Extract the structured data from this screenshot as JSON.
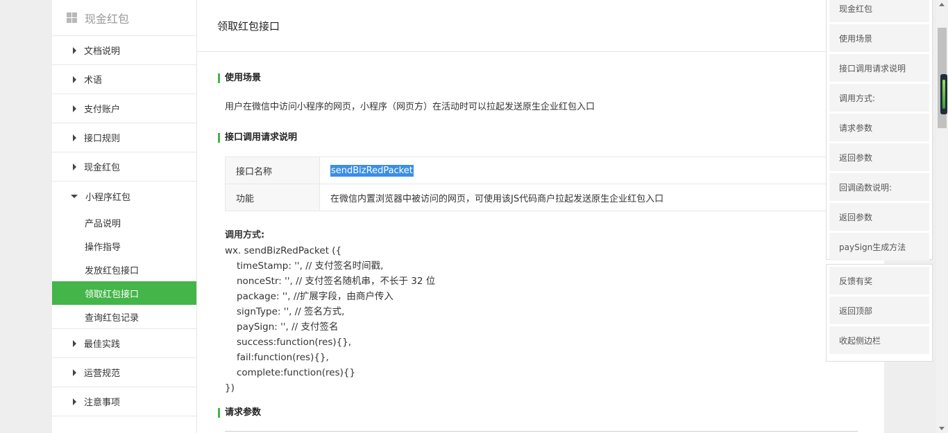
{
  "sidebar": {
    "header": "现金红包",
    "items": [
      {
        "label": "文档说明"
      },
      {
        "label": "术语"
      },
      {
        "label": "支付账户"
      },
      {
        "label": "接口规则"
      },
      {
        "label": "现金红包"
      }
    ],
    "open_group": {
      "label": "小程序红包",
      "children": [
        {
          "label": "产品说明"
        },
        {
          "label": "操作指导"
        },
        {
          "label": "发放红包接口"
        },
        {
          "label": "领取红包接口",
          "active": true
        },
        {
          "label": "查询红包记录"
        }
      ]
    },
    "after_items": [
      {
        "label": "最佳实践"
      },
      {
        "label": "运营规范"
      },
      {
        "label": "注意事项"
      }
    ]
  },
  "main": {
    "page_title": "领取红包接口",
    "sections": {
      "usage_title": "使用场景",
      "usage_text": "用户在微信中访问小程序的网页，小程序（网页方）在活动时可以拉起发送原生企业红包入口",
      "request_title": "接口调用请求说明",
      "params_title": "请求参数"
    },
    "api_table": {
      "rows": [
        {
          "key": "接口名称",
          "value": "sendBizRedPacket"
        },
        {
          "key": "功能",
          "value": "在微信内置浏览器中被访问的网页，可使用该JS代码商户拉起发送原生企业红包入口"
        }
      ]
    },
    "call_method": {
      "title": "调用方式:",
      "lines": [
        "wx. sendBizRedPacket ({",
        "timeStamp: '', // 支付签名时间戳,",
        "nonceStr: '', // 支付签名随机串，不长于 32 位",
        "package: '', //扩展字段，由商户传入",
        "signType: '', // 签名方式,",
        "paySign: '', // 支付签名",
        "success:function(res){},",
        "fail:function(res){},",
        "complete:function(res){}",
        "})"
      ]
    }
  },
  "right_nav": {
    "items": [
      "现金红包",
      "使用场景",
      "接口调用请求说明",
      "调用方式:",
      "请求参数",
      "返回参数",
      "回调函数说明:",
      "返回参数",
      "paySign生成方法"
    ],
    "actions": [
      "反馈有奖",
      "返回顶部",
      "收起侧边栏"
    ]
  },
  "colors": {
    "accent": "#44b549",
    "highlight": "#3a8ee6"
  }
}
